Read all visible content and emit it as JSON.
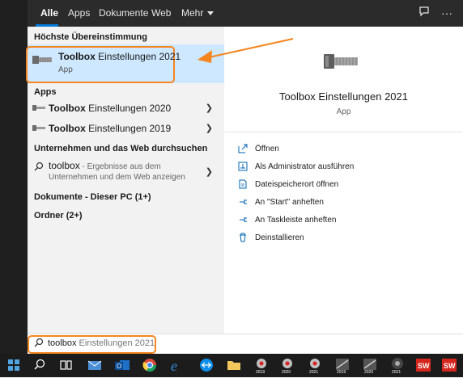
{
  "tabs": [
    {
      "label": "Alle",
      "active": true
    },
    {
      "label": "Apps"
    },
    {
      "label": "Dokumente"
    },
    {
      "label": "Web"
    },
    {
      "label": "Mehr"
    }
  ],
  "topbar": {
    "feedback_icon": "feedback-icon",
    "more_icon": "ellipsis-icon"
  },
  "left": {
    "best_match_header": "Höchste Übereinstimmung",
    "best_match": {
      "title_bold": "Toolbox",
      "title_rest": " Einstellungen 2021",
      "subtitle": "App"
    },
    "apps_header": "Apps",
    "apps": [
      {
        "bold": "Toolbox",
        "rest": " Einstellungen 2020"
      },
      {
        "bold": "Toolbox",
        "rest": " Einstellungen 2019"
      }
    ],
    "web_header": "Unternehmen und das Web durchsuchen",
    "web_item": {
      "query": "toolbox",
      "suffix": " - Ergebnisse aus dem",
      "line2": "Unternehmen und dem Web anzeigen"
    },
    "documents_header": "Dokumente - Dieser PC (1+)",
    "folders_header": "Ordner (2+)"
  },
  "right": {
    "title": "Toolbox Einstellungen 2021",
    "subtitle": "App",
    "actions": [
      {
        "label": "Öffnen",
        "icon": "open-icon"
      },
      {
        "label": "Als Administrator ausführen",
        "icon": "shield-admin-icon"
      },
      {
        "label": "Dateispeicherort öffnen",
        "icon": "file-location-icon"
      },
      {
        "label": "An \"Start\" anheften",
        "icon": "pin-start-icon"
      },
      {
        "label": "An Taskleiste anheften",
        "icon": "pin-taskbar-icon"
      },
      {
        "label": "Deinstallieren",
        "icon": "trash-icon"
      }
    ]
  },
  "search": {
    "typed": "toolbox",
    "hint": " Einstellungen 2021"
  },
  "taskbar": {
    "items": [
      "start",
      "search",
      "task-view",
      "mail",
      "outlook",
      "chrome",
      "edge",
      "teamviewer",
      "explorer",
      "solidworks-2019",
      "solidworks-2020",
      "solidworks-2021",
      "app-2019",
      "app-2020",
      "app-2021",
      "solidworks",
      "solidworks-2"
    ],
    "badges": [
      "2019",
      "2020",
      "2021",
      "2019",
      "2020",
      "2021"
    ]
  },
  "colors": {
    "accent": "#0078d7",
    "highlight": "#cde8ff",
    "annotation": "#f5851f"
  }
}
